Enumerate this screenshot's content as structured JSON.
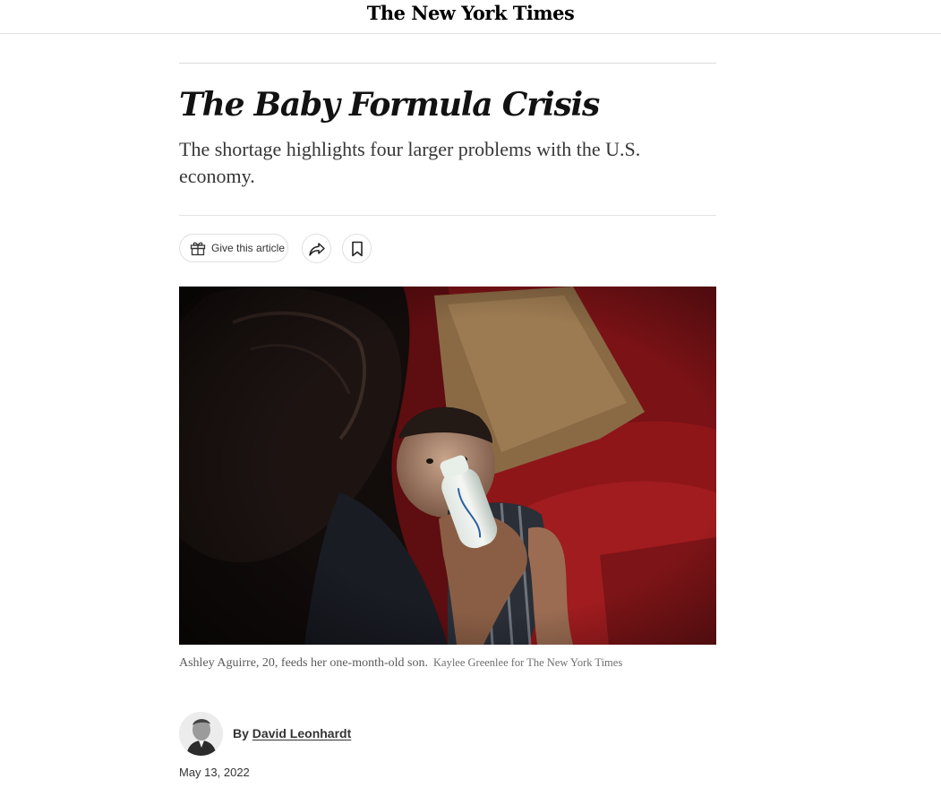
{
  "masthead": {
    "logo_text": "The New York Times"
  },
  "article": {
    "headline": "The Baby Formula Crisis",
    "summary": "The shortage highlights four larger problems with the U.S. economy.",
    "actions": {
      "gift_label": "Give this article",
      "gift_icon": "gift-icon",
      "share_icon": "share-arrow-icon",
      "save_icon": "bookmark-icon"
    },
    "photo": {
      "caption": "Ashley Aguirre, 20, feeds her one-month-old son.",
      "credit": "Kaylee Greenlee for The New York Times"
    },
    "byline": {
      "prefix": "By",
      "author": "David Leonhardt"
    },
    "date": "May 13, 2022"
  }
}
